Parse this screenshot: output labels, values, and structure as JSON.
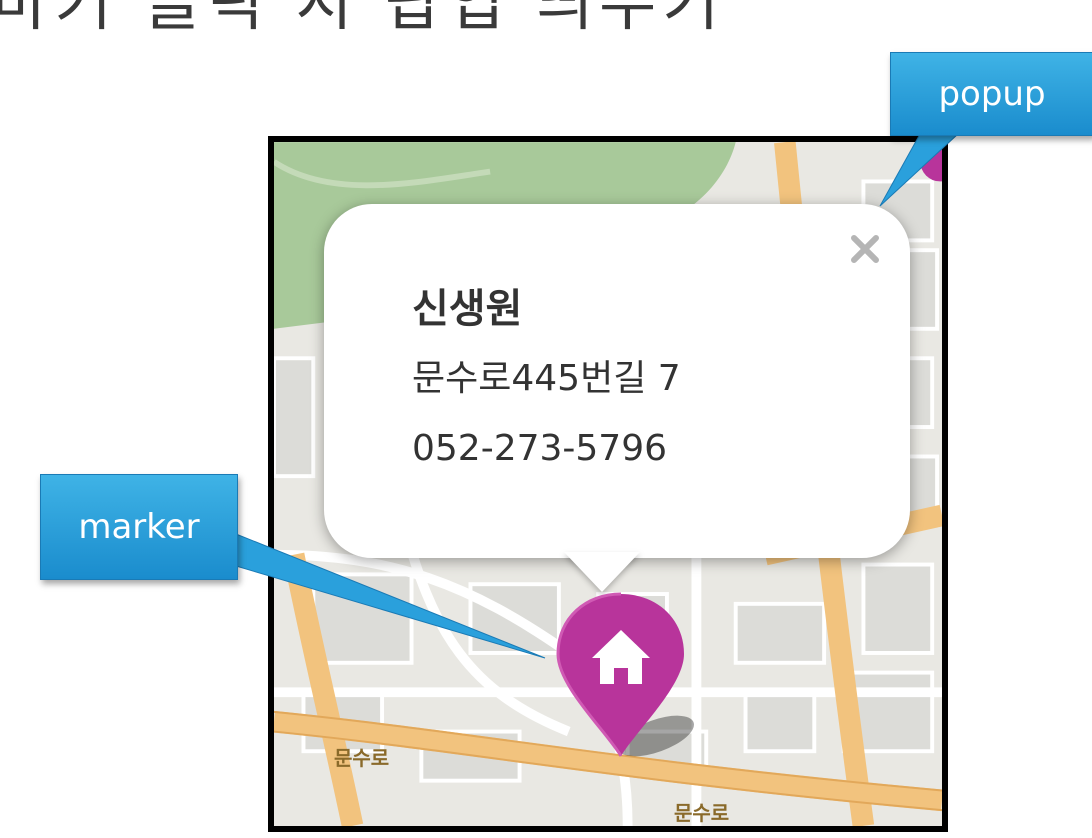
{
  "slide": {
    "title": "마커 클릭 시 팝업 띄우기"
  },
  "popup": {
    "place_name": "신생원",
    "address": "문수로445번길 7",
    "phone": "052-273-5796"
  },
  "map": {
    "road_label_1": "문수로",
    "road_label_2": "문수로"
  },
  "annotations": {
    "popup_label": "popup",
    "marker_label": "marker"
  },
  "colors": {
    "marker": "#b8349b",
    "callout": "#2aa0dc",
    "road": "#f2c37e",
    "park": "#a8c99a"
  }
}
